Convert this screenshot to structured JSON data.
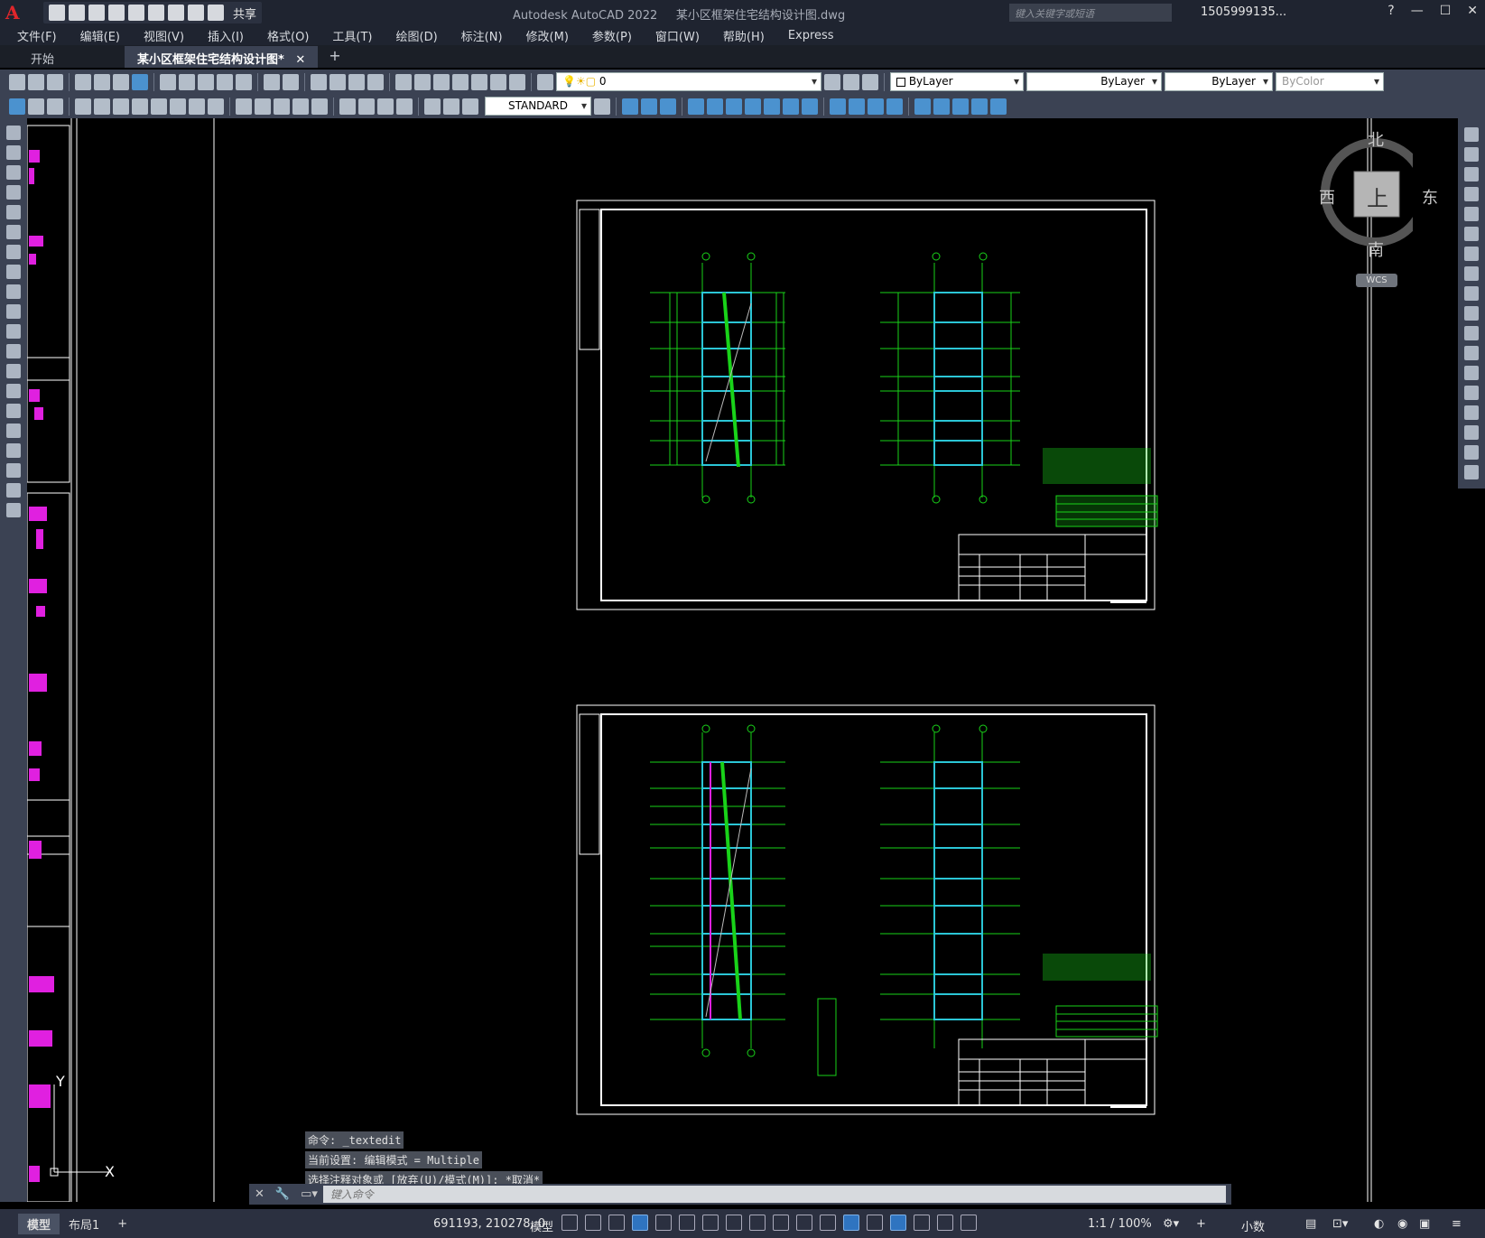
{
  "window": {
    "app_title": "Autodesk AutoCAD 2022",
    "file_title": "某小区框架住宅结构设计图.dwg",
    "search_placeholder": "键入关键字或短语",
    "user": "1505999135...",
    "share_label": "共享"
  },
  "menu": [
    "文件(F)",
    "编辑(E)",
    "视图(V)",
    "插入(I)",
    "格式(O)",
    "工具(T)",
    "绘图(D)",
    "标注(N)",
    "修改(M)",
    "参数(P)",
    "窗口(W)",
    "帮助(H)",
    "Express"
  ],
  "tabs": {
    "start": "开始",
    "active": "某小区框架住宅结构设计图*",
    "plus": "+"
  },
  "properties": {
    "layer": "0",
    "color": "ByLayer",
    "linetype": "ByLayer",
    "lineweight": "ByLayer",
    "plotstyle": "ByColor",
    "textstyle": "STANDARD"
  },
  "viewcube": {
    "north": "北",
    "south": "南",
    "east": "东",
    "west": "西",
    "top": "上",
    "wcs": "WCS"
  },
  "ucs": {
    "x": "X",
    "y": "Y"
  },
  "command": {
    "history": [
      "命令: _textedit",
      "当前设置: 编辑模式 = Multiple",
      "选择注释对象或 [放弃(U)/模式(M)]: *取消*"
    ],
    "placeholder": "键入命令"
  },
  "status": {
    "layout_model": "模型",
    "layout1": "布局1",
    "coords": "691193, 210278, 0",
    "mode": "模型",
    "scale": "1:1 / 100%",
    "units": "小数"
  },
  "colors": {
    "drawing_green": "#19d219",
    "beam_cyan": "#2bc6d6",
    "magenta": "#e020e0",
    "frame_white": "#ffffff"
  }
}
